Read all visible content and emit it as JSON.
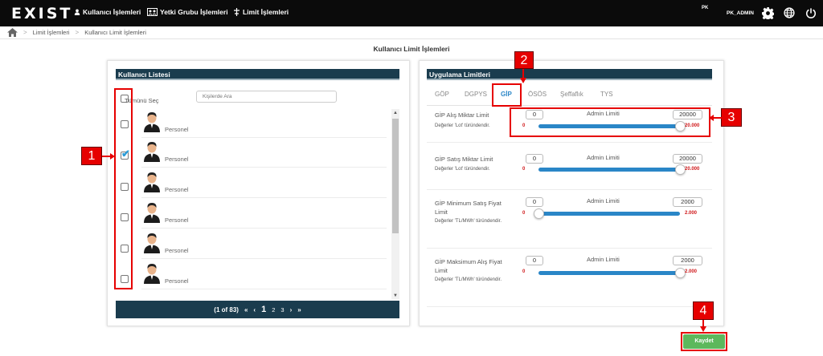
{
  "header": {
    "logo": "EXIST",
    "nav": [
      {
        "label": "Kullanıcı İşlemleri",
        "icon": "user-icon"
      },
      {
        "label": "Yetki Grubu İşlemleri",
        "icon": "group-icon"
      },
      {
        "label": "Limit İşlemleri",
        "icon": "limit-icon"
      }
    ],
    "user_short": "PK",
    "user_name": "PK_ADMIN",
    "icons": [
      "gear-icon",
      "globe-icon",
      "power-icon"
    ]
  },
  "breadcrumb": [
    "Limit İşlemleri",
    "Kullanıcı Limit İşlemleri"
  ],
  "page_title": "Kullanıcı Limit İşlemleri",
  "user_list": {
    "title": "Kullanıcı Listesi",
    "select_all_label": "Tümünü Seç",
    "search_placeholder": "Kişilerde Ara",
    "users": [
      {
        "name": "Personel",
        "checked": false
      },
      {
        "name": "Personel",
        "checked": true
      },
      {
        "name": "Personel",
        "checked": false
      },
      {
        "name": "Personel",
        "checked": false
      },
      {
        "name": "Personel",
        "checked": false
      },
      {
        "name": "Personel",
        "checked": false
      }
    ],
    "pagination": {
      "info": "(1 of 83)",
      "pages": [
        "1",
        "2",
        "3"
      ],
      "current": "1"
    }
  },
  "limits": {
    "title": "Uygulama Limitleri",
    "tabs": [
      "GÖP",
      "DGPYS",
      "GİP",
      "ÖSÖS",
      "Şeffaflık",
      "TYS"
    ],
    "active_tab": "GİP",
    "admin_label": "Admin Limiti",
    "rows": [
      {
        "label": "GİP Alış Miktar Limit",
        "hint": "Değerler 'Lot' türündendir.",
        "value": "0",
        "admin_value": "20000",
        "range_min": "0",
        "range_max": "20.000",
        "level": 1.0
      },
      {
        "label": "GİP Satış Miktar Limit",
        "hint": "Değerler 'Lot' türündendir.",
        "value": "0",
        "admin_value": "20000",
        "range_min": "0",
        "range_max": "20.000",
        "level": 1.0
      },
      {
        "label": "GİP Minimum Satış Fiyat Limit",
        "hint": "Değerler 'TL/MWh' türündendir.",
        "value": "0",
        "admin_value": "2000",
        "range_min": "0",
        "range_max": "2.000",
        "level": 0.0
      },
      {
        "label": "GİP Maksimum Alış Fiyat Limit",
        "hint": "Değerler 'TL/MWh' türündendir.",
        "value": "0",
        "admin_value": "2000",
        "range_min": "0",
        "range_max": "2.000",
        "level": 1.0
      }
    ]
  },
  "save_label": "Kaydet",
  "annotations": [
    "1",
    "2",
    "3",
    "4"
  ],
  "colors": {
    "header": "#0b0b0b",
    "panel_head": "#1a3c4e",
    "accent": "#2a86c7",
    "save": "#5cb85c",
    "annotation": "#e60000",
    "range_text": "#d0191b"
  }
}
